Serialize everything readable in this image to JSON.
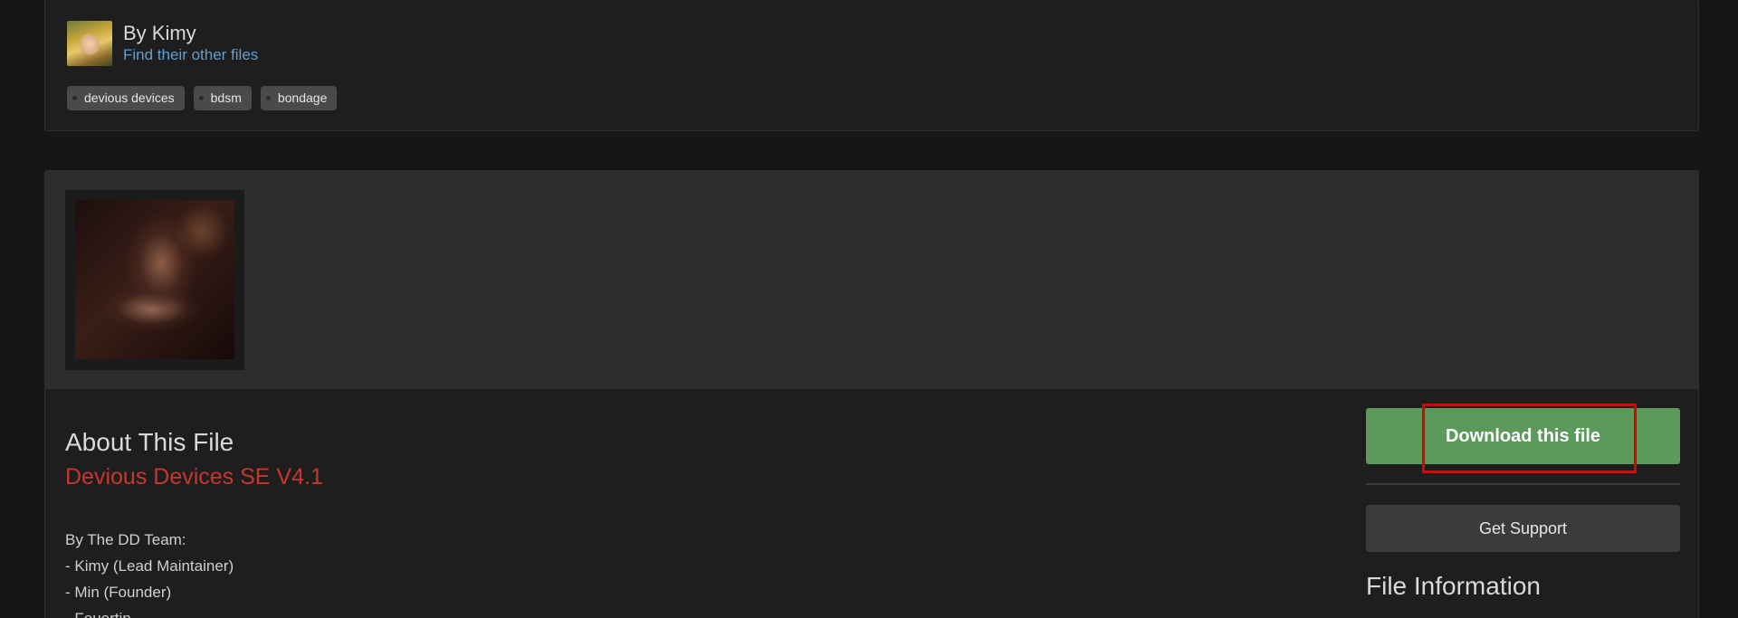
{
  "author": {
    "name": "By Kimy",
    "link_label": "Find their other files"
  },
  "tags": [
    "devious devices",
    "bdsm",
    "bondage"
  ],
  "about": {
    "title": "About This File",
    "file_name": "Devious Devices SE V4.1",
    "description_lines": [
      "By The DD Team:",
      "- Kimy (Lead Maintainer)",
      "- Min (Founder)",
      "- Feuertin"
    ]
  },
  "sidebar": {
    "download_label": "Download this file",
    "support_label": "Get Support",
    "file_info_title": "File Information"
  },
  "colors": {
    "background": "#161616",
    "panel": "#1e1e1e",
    "gallery": "#2d2d2d",
    "download_green": "#5b9a5b",
    "file_name_red": "#c8372d",
    "link_blue": "#5e9fd2",
    "highlight_red": "#e00000"
  }
}
